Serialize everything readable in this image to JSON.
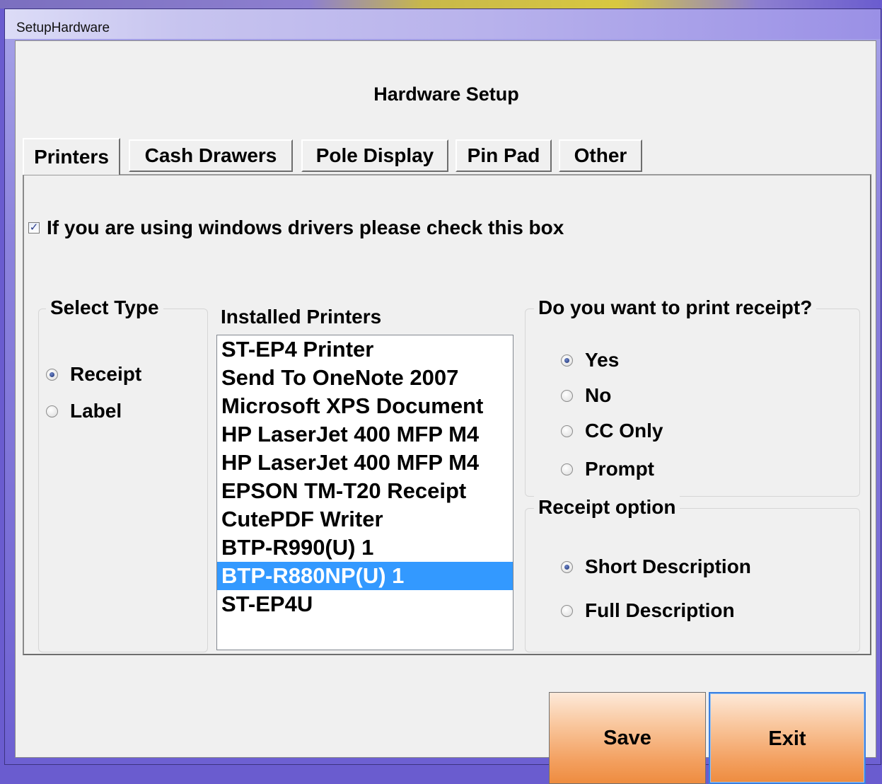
{
  "window": {
    "title": "SetupHardware"
  },
  "heading": "Hardware Setup",
  "tabs": [
    {
      "label": "Printers",
      "active": true
    },
    {
      "label": "Cash Drawers",
      "active": false
    },
    {
      "label": "Pole Display",
      "active": false
    },
    {
      "label": "Pin Pad",
      "active": false
    },
    {
      "label": "Other",
      "active": false
    }
  ],
  "windows_drivers": {
    "label": "If you are using windows drivers please check this box",
    "checked": true
  },
  "select_type": {
    "title": "Select Type",
    "options": [
      {
        "label": "Receipt",
        "selected": true
      },
      {
        "label": "Label",
        "selected": false
      }
    ]
  },
  "installed_printers": {
    "title": "Installed Printers",
    "items": [
      "ST-EP4 Printer",
      "Send To OneNote 2007",
      "Microsoft XPS Document",
      "HP LaserJet 400 MFP M4",
      "HP LaserJet 400 MFP M4",
      "EPSON TM-T20 Receipt",
      "CutePDF Writer",
      "BTP-R990(U) 1",
      "BTP-R880NP(U) 1",
      "ST-EP4U"
    ],
    "selected": "BTP-R880NP(U) 1"
  },
  "print_receipt": {
    "title": "Do you want to print receipt?",
    "options": [
      {
        "label": "Yes",
        "selected": true
      },
      {
        "label": "No",
        "selected": false
      },
      {
        "label": "CC Only",
        "selected": false
      },
      {
        "label": "Prompt",
        "selected": false
      }
    ]
  },
  "receipt_option": {
    "title": "Receipt option",
    "options": [
      {
        "label": "Short Description",
        "selected": true
      },
      {
        "label": "Full Description",
        "selected": false
      }
    ]
  },
  "buttons": {
    "save": "Save",
    "exit": "Exit"
  },
  "colors": {
    "selection": "#3399ff",
    "button_orange": "#ee8c3f",
    "window_frame": "#6d60d2"
  }
}
